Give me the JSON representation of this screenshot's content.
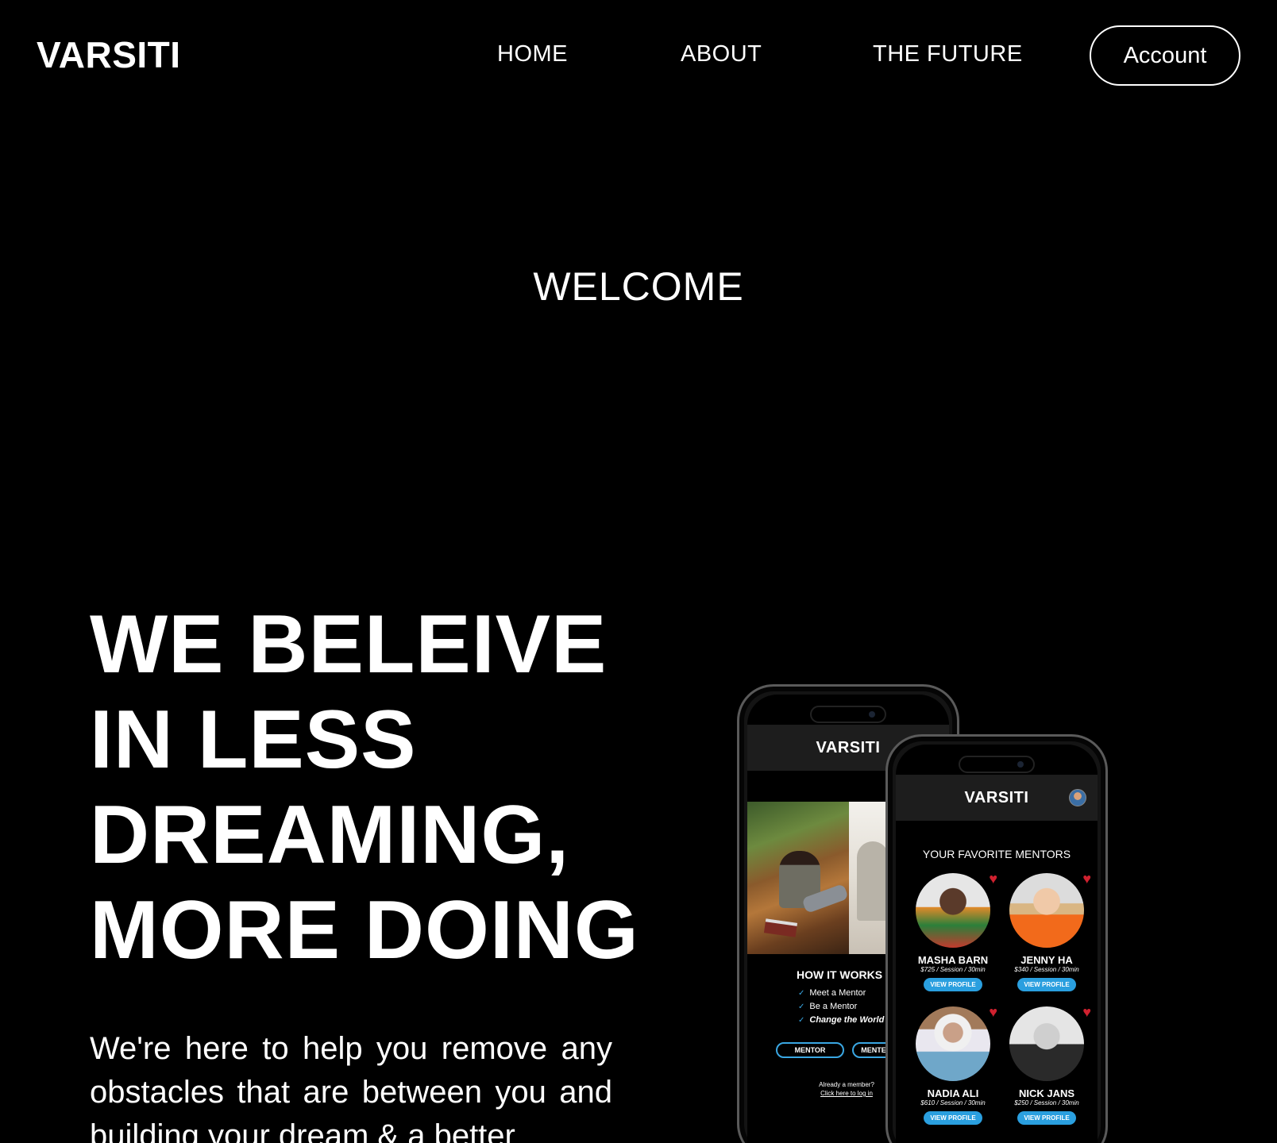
{
  "nav": {
    "logo": "VARSITI",
    "links": [
      "HOME",
      "ABOUT",
      "THE FUTURE"
    ],
    "account_label": "Account"
  },
  "hero": {
    "welcome": "WELCOME",
    "headline": [
      "WE BELEIVE",
      "IN LESS",
      "DREAMING,",
      "MORE DOING"
    ],
    "body": "We're here to help you remove any obstacles that are between you and building your dream & a better"
  },
  "phone_back": {
    "app_title": "VARSITI",
    "how_title": "HOW IT WORKS",
    "how_items": [
      "Meet a Mentor",
      "Be a Mentor",
      "Change the World"
    ],
    "mentor_button": "MENTOR",
    "mentee_button": "MENTEE",
    "already_member": "Already a member?",
    "login_link": "Click here to log in"
  },
  "phone_front": {
    "app_title": "VARSITI",
    "section_title": "YOUR FAVORITE MENTORS",
    "mentors": [
      {
        "name": "MASHA BARN",
        "price": "$725 / Session / 30min",
        "button": "VIEW PROFILE"
      },
      {
        "name": "JENNY HA",
        "price": "$340 / Session / 30min",
        "button": "VIEW PROFILE"
      },
      {
        "name": "NADIA ALI",
        "price": "$610 / Session / 30min",
        "button": "VIEW PROFILE"
      },
      {
        "name": "NICK JANS",
        "price": "$250 / Session / 30min",
        "button": "VIEW PROFILE"
      }
    ]
  },
  "colors": {
    "background": "#000000",
    "text": "#ffffff",
    "accent_blue": "#2a9fdf",
    "heart_red": "#d0212f"
  },
  "icons": [
    "check-icon",
    "heart-icon",
    "avatar"
  ]
}
